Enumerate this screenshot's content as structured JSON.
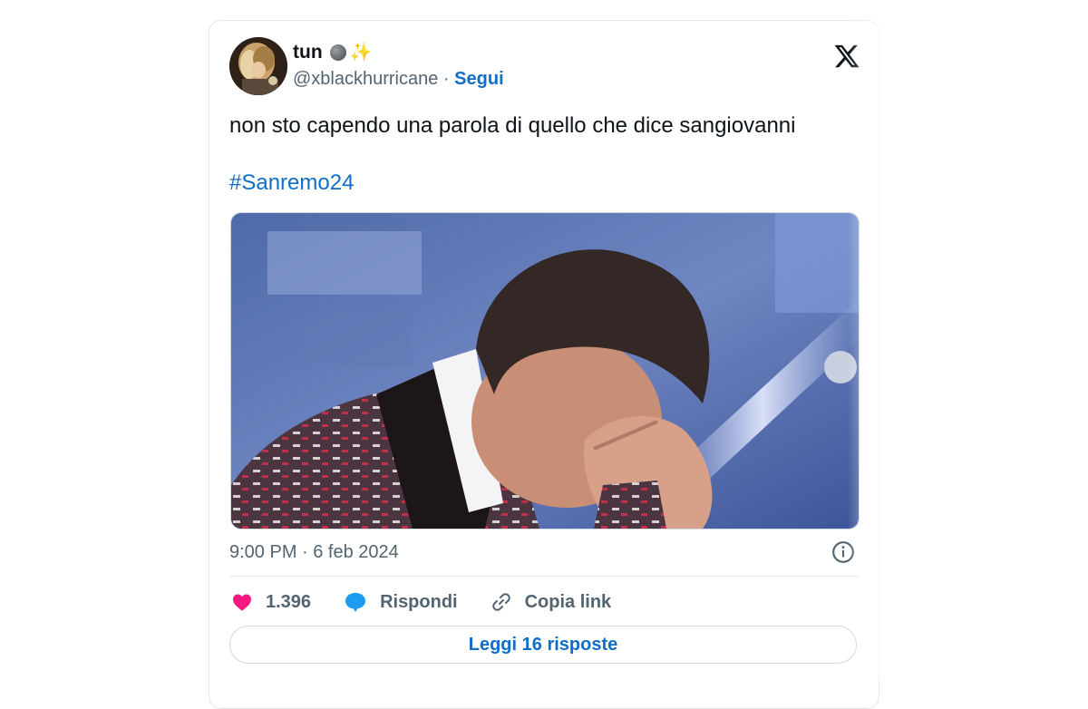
{
  "tweet": {
    "display_name": "tun",
    "name_emojis": [
      "moon-emoji",
      "sparkles-emoji"
    ],
    "handle": "@xblackhurricane",
    "separator": "·",
    "follow_label": "Segui",
    "text": "non sto capendo una parola di quello che dice sangiovanni",
    "hashtag": "#Sanremo24",
    "media": {
      "kind": "photo",
      "description_icon": "photo-image"
    },
    "timestamp": "9:00 PM · 6 feb 2024",
    "actions": {
      "likes_count": "1.396",
      "reply_label": "Rispondi",
      "copy_link_label": "Copia link"
    },
    "read_replies_label": "Leggi 16 risposte"
  },
  "icons": {
    "platform": "x-logo-icon",
    "info": "info-icon",
    "like": "heart-icon",
    "reply": "speech-bubble-icon",
    "link": "link-icon"
  },
  "colors": {
    "accent": "#0f6ec7",
    "heart": "#f91880",
    "reply_bubble": "#1d9bf0",
    "muted_text": "#536471",
    "text": "#0f1419",
    "border": "#cfd9de"
  }
}
